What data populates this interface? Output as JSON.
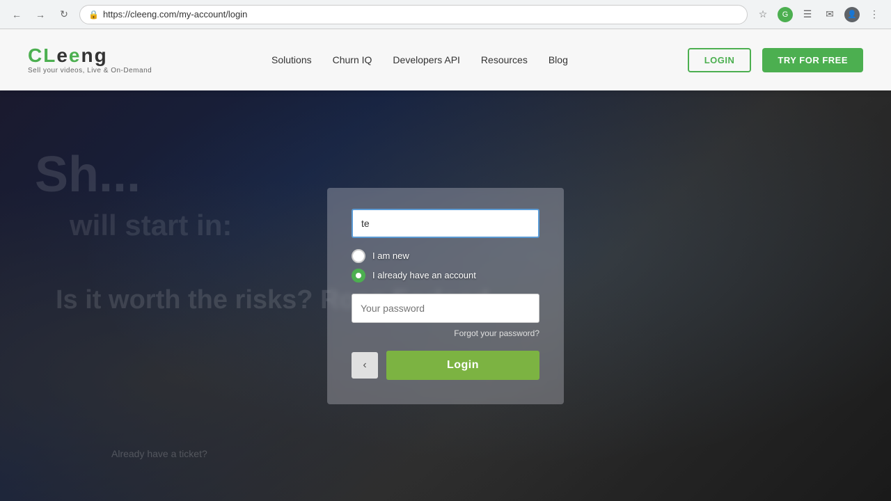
{
  "browser": {
    "url": "https://cleeng.com/my-account/login",
    "back_title": "Back",
    "forward_title": "Forward",
    "refresh_title": "Refresh"
  },
  "navbar": {
    "logo": "CLeeng",
    "logo_tagline": "Sell your videos, Live & On-Demand",
    "links": [
      {
        "label": "Solutions",
        "id": "solutions"
      },
      {
        "label": "Churn IQ",
        "id": "churniq"
      },
      {
        "label": "Developers API",
        "id": "devapi"
      },
      {
        "label": "Resources",
        "id": "resources"
      },
      {
        "label": "Blog",
        "id": "blog"
      }
    ],
    "login_label": "LOGIN",
    "try_label": "TRY FOR FREE"
  },
  "login_form": {
    "email_value": "te",
    "email_placeholder": "",
    "radio_new_label": "I am new",
    "radio_existing_label": "I already have an account",
    "password_placeholder": "Your password",
    "forgot_label": "Forgot your password?",
    "back_arrow": "‹",
    "login_button_label": "Login"
  }
}
